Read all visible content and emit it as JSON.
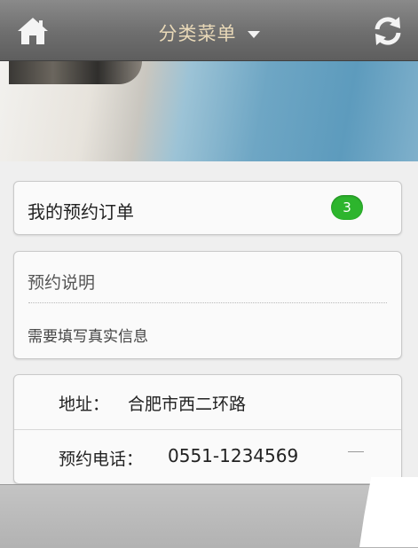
{
  "header": {
    "menu_title": "分类菜单",
    "home_icon": "home-icon",
    "refresh_icon": "refresh-icon",
    "title_color": "#e9d9b8"
  },
  "banner": {
    "image": "beach-banner-image"
  },
  "orders": {
    "label": "我的预约订单",
    "count": "3",
    "badge_color": "#2db52d"
  },
  "instructions": {
    "title": "预约说明",
    "text": "需要填写真实信息"
  },
  "contact": {
    "address_label": "地址：",
    "address_value": "合肥市西二环路",
    "phone_label": "预约电话：",
    "phone_value": "0551-1234569"
  }
}
